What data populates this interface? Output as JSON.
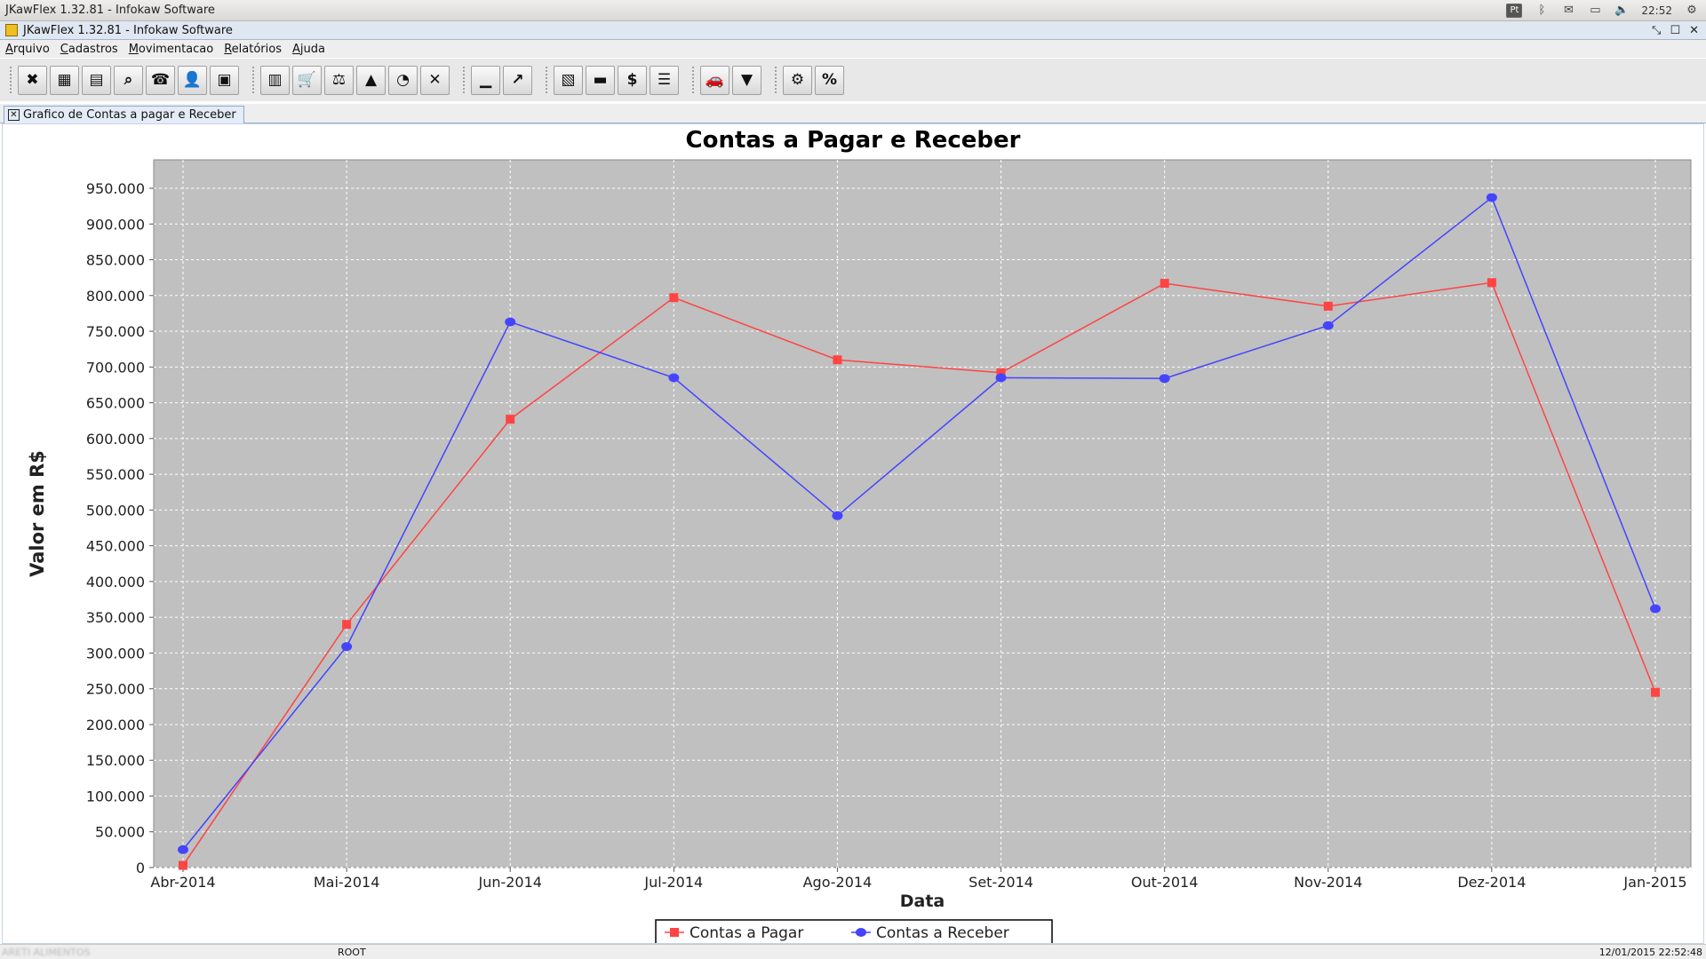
{
  "os": {
    "title": "JKawFlex 1.32.81 - Infokaw Software",
    "kbd": "Pt",
    "time": "22:52"
  },
  "window": {
    "title": "JKawFlex 1.32.81 - Infokaw Software"
  },
  "menu": [
    "Arquivo",
    "Cadastros",
    "Movimentacao",
    "Relatórios",
    "Ajuda"
  ],
  "toolbar": {
    "groups": [
      [
        "close-icon",
        "calculator-icon",
        "calendar-icon",
        "search-icon",
        "phone-icon",
        "user-icon",
        "box-icon"
      ],
      [
        "cash-register-icon",
        "cart-icon",
        "scale-icon",
        "road-icon",
        "rss-icon",
        "cancel-icon"
      ],
      [
        "bar-chart-icon",
        "trend-chart-icon"
      ],
      [
        "money-icon",
        "banknote-icon",
        "money-bag-icon",
        "ledger-icon"
      ],
      [
        "car-icon",
        "filter-icon"
      ],
      [
        "gear-percent-icon",
        "percent-icon"
      ]
    ]
  },
  "tab": {
    "label": "Grafico de Contas a pagar e Receber"
  },
  "chart_data": {
    "type": "line",
    "title": "Contas a Pagar e  Receber",
    "xlabel": "Data",
    "ylabel": "Valor em R$",
    "categories": [
      "Abr-2014",
      "Mai-2014",
      "Jun-2014",
      "Jul-2014",
      "Ago-2014",
      "Set-2014",
      "Out-2014",
      "Nov-2014",
      "Dez-2014",
      "Jan-2015"
    ],
    "ylim": [
      0,
      950000
    ],
    "yticks": [
      0,
      50000,
      100000,
      150000,
      200000,
      250000,
      300000,
      350000,
      400000,
      450000,
      500000,
      550000,
      600000,
      650000,
      700000,
      750000,
      800000,
      850000,
      900000,
      950000
    ],
    "ytick_labels": [
      "0",
      "50.000",
      "100.000",
      "150.000",
      "200.000",
      "250.000",
      "300.000",
      "350.000",
      "400.000",
      "450.000",
      "500.000",
      "550.000",
      "600.000",
      "650.000",
      "700.000",
      "750.000",
      "800.000",
      "850.000",
      "900.000",
      "950.000"
    ],
    "grid": true,
    "legend": "bottom-center",
    "series": [
      {
        "name": "Contas a Pagar",
        "color": "#ff4444",
        "marker": "square",
        "values": [
          3000,
          340000,
          627000,
          797000,
          710000,
          692000,
          817000,
          785000,
          818000,
          245000
        ]
      },
      {
        "name": "Contas a Receber",
        "color": "#4444ff",
        "marker": "circle",
        "values": [
          25000,
          309000,
          763000,
          685000,
          492000,
          685000,
          684000,
          758000,
          937000,
          362000
        ]
      }
    ]
  },
  "status": {
    "company": "ARETI ALIMENTOS",
    "user": "ROOT",
    "datetime": "12/01/2015 22:52:48"
  },
  "colors": {
    "plot_bg": "#c0c0c0",
    "tab_bg": "#e4ecf7"
  }
}
